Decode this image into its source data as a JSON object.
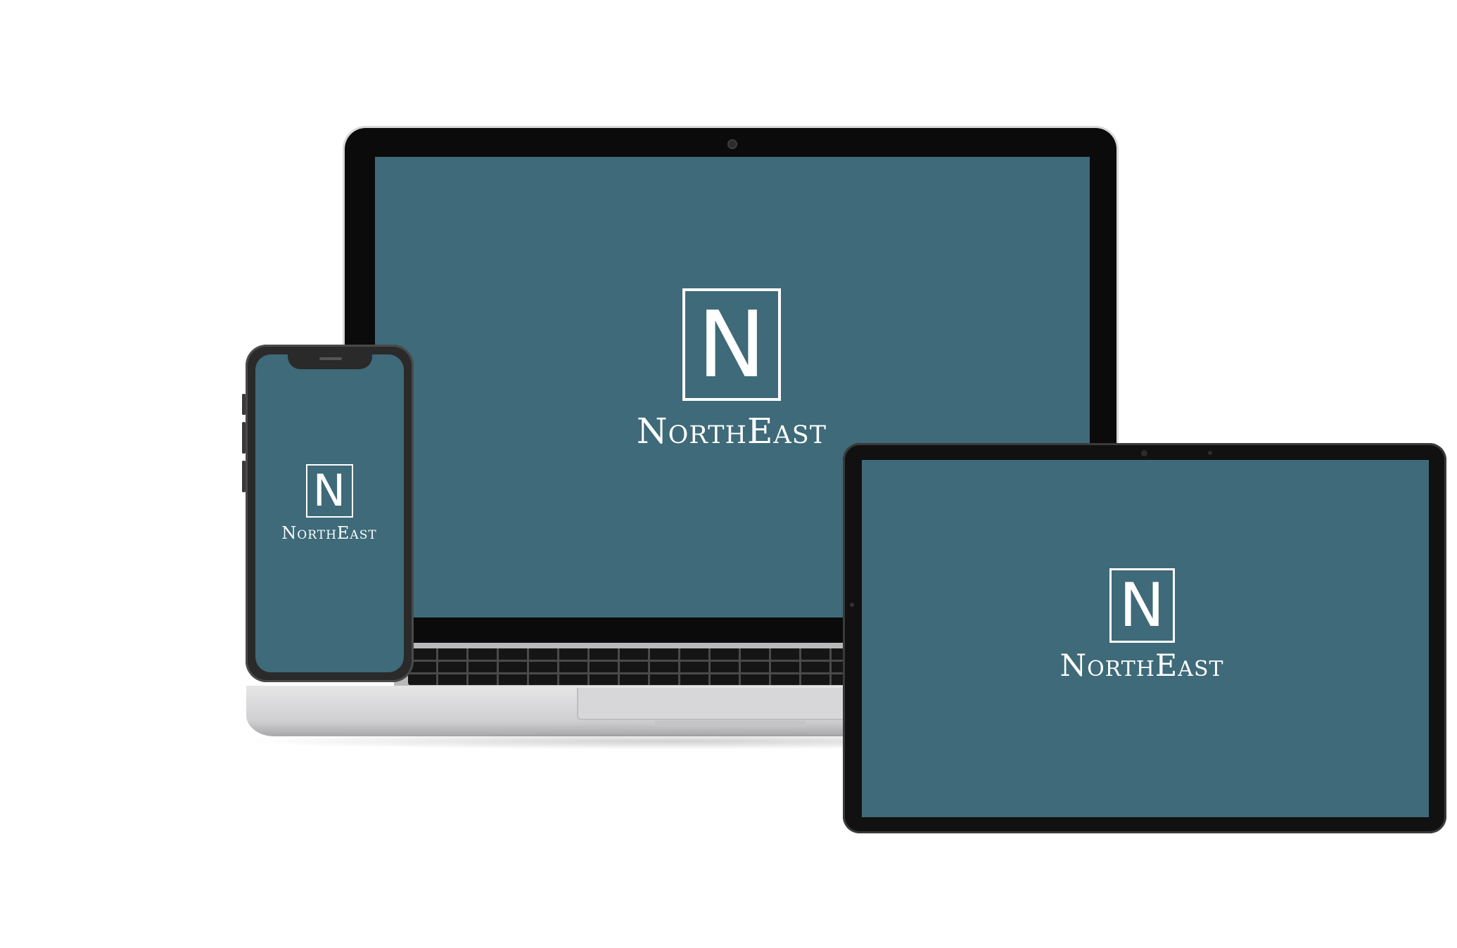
{
  "brand": {
    "mark": "N",
    "name": "NorthEast"
  },
  "colors": {
    "screen": "#3e6a79",
    "logo": "#ffffff",
    "device_frame": "#0b0b0b",
    "laptop_base": "#cfcfd1"
  },
  "devices": {
    "laptop": {
      "mark": "N",
      "name": "NorthEast"
    },
    "phone": {
      "mark": "N",
      "name": "NorthEast"
    },
    "tablet": {
      "mark": "N",
      "name": "NorthEast"
    }
  }
}
